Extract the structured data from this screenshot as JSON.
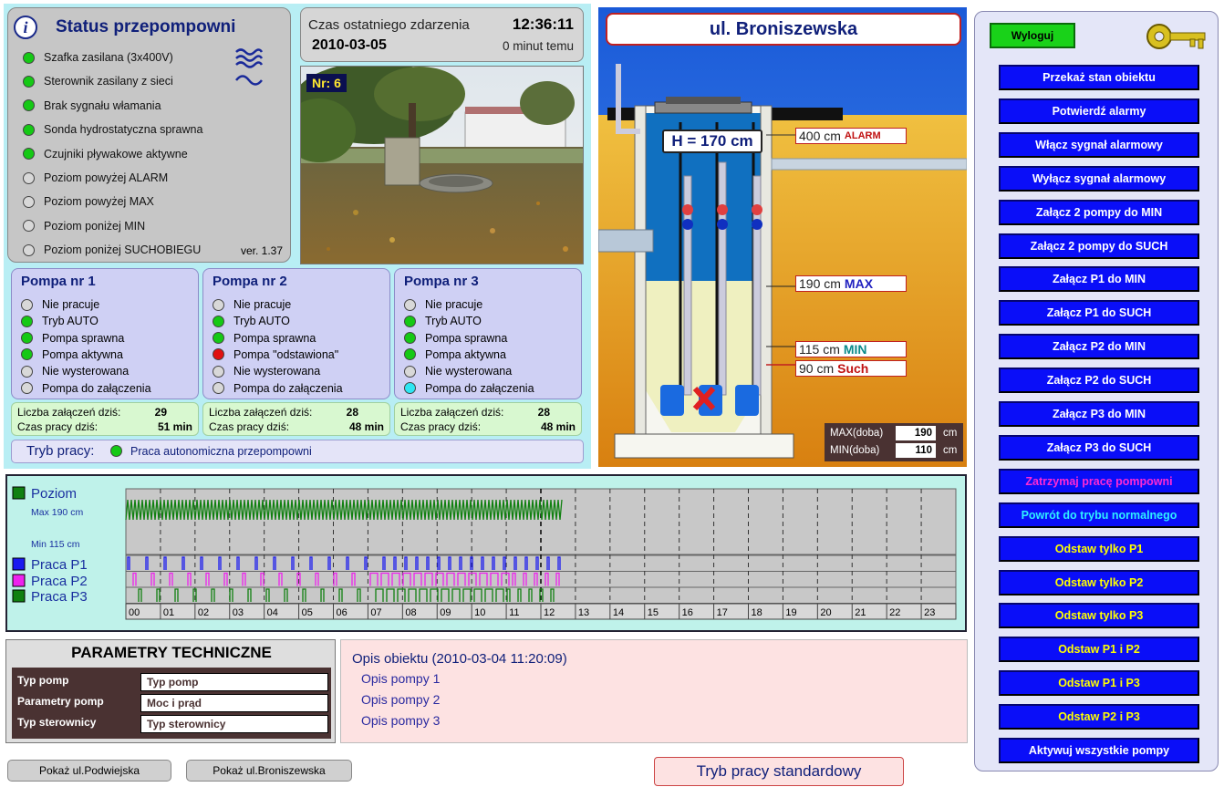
{
  "status": {
    "title": "Status przepompowni",
    "version": "ver. 1.37",
    "items": [
      {
        "label": "Szafka zasilana (3x400V)",
        "state": "green"
      },
      {
        "label": "Sterownik zasilany z sieci",
        "state": "green"
      },
      {
        "label": "Brak sygnału włamania",
        "state": "green"
      },
      {
        "label": "Sonda hydrostatyczna sprawna",
        "state": "green"
      },
      {
        "label": "Czujniki pływakowe aktywne",
        "state": "green"
      },
      {
        "label": "Poziom powyżej ALARM",
        "state": "empty"
      },
      {
        "label": "Poziom powyżej MAX",
        "state": "empty"
      },
      {
        "label": "Poziom poniżej MIN",
        "state": "empty"
      },
      {
        "label": "Poziom poniżej SUCHOBIEGU",
        "state": "empty"
      }
    ]
  },
  "event": {
    "label": "Czas ostatniego zdarzenia",
    "time": "12:36:11",
    "date": "2010-03-05",
    "ago": "0 minut temu"
  },
  "photo": {
    "nr": "Nr: 6"
  },
  "pumps": [
    {
      "title": "Pompa nr 1",
      "rows": [
        [
          "Nie pracuje",
          "empty"
        ],
        [
          "Tryb AUTO",
          "green"
        ],
        [
          "Pompa sprawna",
          "green"
        ],
        [
          "Pompa aktywna",
          "green"
        ],
        [
          "Nie wysterowana",
          "empty"
        ],
        [
          "Pompa do załączenia",
          "empty"
        ]
      ],
      "count_label": "Liczba załączeń dziś:",
      "count": "29",
      "time_label": "Czas pracy dziś:",
      "time": "51 min"
    },
    {
      "title": "Pompa nr 2",
      "rows": [
        [
          "Nie pracuje",
          "empty"
        ],
        [
          "Tryb AUTO",
          "green"
        ],
        [
          "Pompa sprawna",
          "green"
        ],
        [
          "Pompa \"odstawiona\"",
          "red"
        ],
        [
          "Nie wysterowana",
          "empty"
        ],
        [
          "Pompa do załączenia",
          "empty"
        ]
      ],
      "count_label": "Liczba załączeń dziś:",
      "count": "28",
      "time_label": "Czas pracy dziś:",
      "time": "48 min"
    },
    {
      "title": "Pompa nr 3",
      "rows": [
        [
          "Nie pracuje",
          "empty"
        ],
        [
          "Tryb AUTO",
          "green"
        ],
        [
          "Pompa sprawna",
          "green"
        ],
        [
          "Pompa aktywna",
          "green"
        ],
        [
          "Nie wysterowana",
          "empty"
        ],
        [
          "Pompa do załączenia",
          "cyan"
        ]
      ],
      "count_label": "Liczba załączeń dziś:",
      "count": "28",
      "time_label": "Czas pracy dziś:",
      "time": "48 min"
    }
  ],
  "mode": {
    "label": "Tryb pracy:",
    "value": "Praca autonomiczna przepompowni"
  },
  "tank": {
    "street": "ul. Broniszewska",
    "h": "H = 170 cm",
    "levels": [
      {
        "value": "400 cm",
        "tag": "ALARM",
        "color": "#c01010"
      },
      {
        "value": "190 cm",
        "tag": "MAX",
        "color": "#2222c0"
      },
      {
        "value": "115 cm",
        "tag": "MIN",
        "color": "#0a8a8a"
      },
      {
        "value": "90 cm",
        "tag": "Such",
        "color": "#c01010"
      }
    ],
    "max_label": "MAX(doba)",
    "max_value": "190",
    "min_label": "MIN(doba)",
    "min_value": "110",
    "unit": "cm"
  },
  "buttons": {
    "logout": "Wyloguj",
    "key_icon": "key-icon",
    "list": [
      {
        "label": "Przekaż stan obiektu",
        "color": "#ffffff"
      },
      {
        "label": "Potwierdź alarmy",
        "color": "#ffffff"
      },
      {
        "label": "Włącz sygnał alarmowy",
        "color": "#ffffff"
      },
      {
        "label": "Wyłącz sygnał alarmowy",
        "color": "#ffffff"
      },
      {
        "label": "Załącz 2 pompy do MIN",
        "color": "#ffffff"
      },
      {
        "label": "Załącz 2 pompy do SUCH",
        "color": "#ffffff"
      },
      {
        "label": "Załącz P1 do MIN",
        "color": "#ffffff"
      },
      {
        "label": "Załącz P1 do SUCH",
        "color": "#ffffff"
      },
      {
        "label": "Załącz P2 do MIN",
        "color": "#ffffff"
      },
      {
        "label": "Załącz P2 do SUCH",
        "color": "#ffffff"
      },
      {
        "label": "Załącz P3 do MIN",
        "color": "#ffffff"
      },
      {
        "label": "Załącz P3 do SUCH",
        "color": "#ffffff"
      },
      {
        "label": "Zatrzymaj pracę pompowni",
        "color": "#ff2ad4"
      },
      {
        "label": "Powrót do trybu normalnego",
        "color": "#2ef0ff"
      },
      {
        "label": "Odstaw tylko P1",
        "color": "#ffff00"
      },
      {
        "label": "Odstaw tylko P2",
        "color": "#ffff00"
      },
      {
        "label": "Odstaw tylko P3",
        "color": "#ffff00"
      },
      {
        "label": "Odstaw P1 i P2",
        "color": "#ffff00"
      },
      {
        "label": "Odstaw P1 i P3",
        "color": "#ffff00"
      },
      {
        "label": "Odstaw P2 i P3",
        "color": "#ffff00"
      },
      {
        "label": "Aktywuj wszystkie pompy",
        "color": "#ffffff"
      }
    ]
  },
  "chart_data": {
    "type": "line",
    "series": [
      {
        "name": "Poziom",
        "color": "#108010"
      },
      {
        "name": "Praca P1",
        "color": "#1a1af0"
      },
      {
        "name": "Praca P2",
        "color": "#ee22ee"
      },
      {
        "name": "Praca P3",
        "color": "#108010"
      }
    ],
    "level_max_label": "Max 190 cm",
    "level_min_label": "Min 115 cm",
    "x_ticks": [
      "00",
      "01",
      "02",
      "03",
      "04",
      "05",
      "06",
      "07",
      "08",
      "09",
      "10",
      "11",
      "12",
      "13",
      "14",
      "15",
      "16",
      "17",
      "18",
      "19",
      "20",
      "21",
      "22",
      "23"
    ],
    "x_range": [
      0,
      24
    ],
    "current_hour": 12.6,
    "level_range_cm": [
      115,
      190
    ],
    "grid": true
  },
  "params": {
    "title": "PARAMETRY TECHNICZNE",
    "rows": [
      {
        "label": "Typ pomp",
        "value": "Typ pomp"
      },
      {
        "label": "Parametry pomp",
        "value": "Moc i prąd"
      },
      {
        "label": "Typ sterownicy",
        "value": "Typ sterownicy"
      }
    ]
  },
  "desc": {
    "title": "Opis obiektu (2010-03-04 11:20:09)",
    "lines": [
      "Opis pompy 1",
      "Opis pompy 2",
      "Opis pompy 3"
    ]
  },
  "footer": {
    "show1": "Pokaż ul.Podwiejska",
    "show2": "Pokaż ul.Broniszewska",
    "mode": "Tryb pracy standardowy"
  }
}
